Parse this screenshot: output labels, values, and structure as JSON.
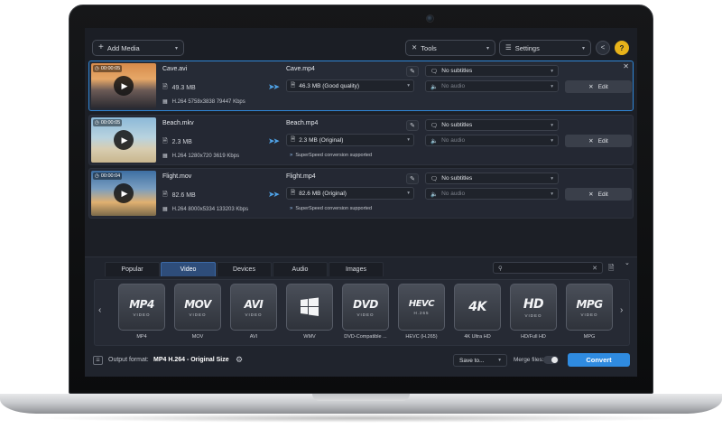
{
  "toolbar": {
    "add_media_label": "Add Media",
    "tools_label": "Tools",
    "settings_label": "Settings",
    "help_label": "?"
  },
  "files": [
    {
      "duration": "00:00:05",
      "source_name": "Cave.avi",
      "source_size": "49.3 MB",
      "source_spec": "H.264 5758x3838 79447 Kbps",
      "output_name": "Cave.mp4",
      "output_size": "46.3 MB (Good quality)",
      "superspeed": "",
      "subtitles": "No subtitles",
      "audio": "No audio",
      "edit_label": "Edit",
      "selected": true
    },
    {
      "duration": "00:00:05",
      "source_name": "Beach.mkv",
      "source_size": "2.3 MB",
      "source_spec": "H.264 1280x720 3619 Kbps",
      "output_name": "Beach.mp4",
      "output_size": "2.3 MB (Original)",
      "superspeed": "SuperSpeed conversion supported",
      "subtitles": "No subtitles",
      "audio": "No audio",
      "edit_label": "Edit",
      "selected": false
    },
    {
      "duration": "00:00:04",
      "source_name": "Flight.mov",
      "source_size": "82.6 MB",
      "source_spec": "H.264 8000x5334 133203 Kbps",
      "output_name": "Flight.mp4",
      "output_size": "82.6 MB (Original)",
      "superspeed": "SuperSpeed conversion supported",
      "subtitles": "No subtitles",
      "audio": "No audio",
      "edit_label": "Edit",
      "selected": false
    }
  ],
  "tabs": [
    {
      "label": "Popular",
      "active": false
    },
    {
      "label": "Video",
      "active": true
    },
    {
      "label": "Devices",
      "active": false
    },
    {
      "label": "Audio",
      "active": false
    },
    {
      "label": "Images",
      "active": false
    }
  ],
  "search": {
    "placeholder": ""
  },
  "formats": [
    {
      "tile": "MP4",
      "sub": "VIDEO",
      "label": "MP4"
    },
    {
      "tile": "MOV",
      "sub": "VIDEO",
      "label": "MOV"
    },
    {
      "tile": "AVI",
      "sub": "VIDEO",
      "label": "AVI"
    },
    {
      "tile": "",
      "sub": "",
      "label": "WMV"
    },
    {
      "tile": "DVD",
      "sub": "VIDEO",
      "label": "DVD-Compatible ..."
    },
    {
      "tile": "HEVC",
      "sub": "H.265",
      "label": "HEVC (H.265)"
    },
    {
      "tile": "4K",
      "sub": "",
      "label": "4K Ultra HD"
    },
    {
      "tile": "HD",
      "sub": "VIDEO",
      "label": "HD/Full HD"
    },
    {
      "tile": "MPG",
      "sub": "VIDEO",
      "label": "MPG"
    }
  ],
  "status": {
    "output_format_label": "Output format:",
    "output_format_value": "MP4 H.264 - Original Size",
    "save_to_label": "Save to...",
    "merge_label": "Merge files:",
    "merge_on": false,
    "convert_label": "Convert"
  },
  "colors": {
    "accent": "#2f8be0",
    "selected_border": "#2f86d6",
    "background": "#1c1f26"
  }
}
